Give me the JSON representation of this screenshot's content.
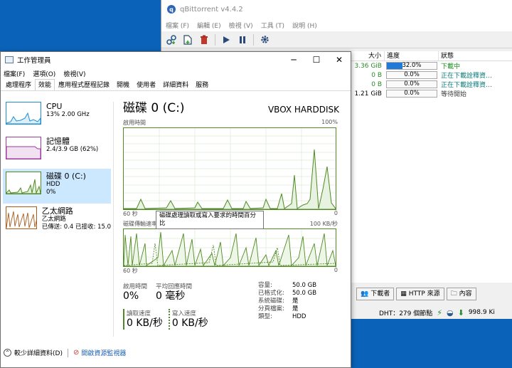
{
  "qbittorrent": {
    "title": "qBittorrent v4.4.2",
    "menu": [
      "檔案 (F)",
      "編輯 (E)",
      "檢視 (V)",
      "工具 (T)",
      "說明 (H)"
    ],
    "columns": {
      "size": "大小",
      "progress": "進度",
      "status": "狀態"
    },
    "rows": [
      {
        "size": "3.36 GiB",
        "progress_text": "32.0%",
        "progress": 0.32,
        "status": "下載中"
      },
      {
        "size": "0 B",
        "progress_text": "0.0%",
        "progress": 0,
        "status": "正在下載詮釋資…"
      },
      {
        "size": "0 B",
        "progress_text": "0.0%",
        "progress": 0,
        "status": "正在下載詮釋資…"
      },
      {
        "size": "1.21 GiB",
        "progress_text": "0.0%",
        "progress": 0,
        "status": "等待開始"
      }
    ],
    "tabs": {
      "peers": "下載者",
      "http": "HTTP 來源",
      "content": "內容"
    },
    "status_bar": {
      "dht": "DHT：279 個節點",
      "speed": "998.9 Ki"
    }
  },
  "taskmgr": {
    "title": "工作管理員",
    "menu": {
      "file": "檔案(F)",
      "options": "選項(O)",
      "view": "檢視(V)"
    },
    "tabs": [
      "處理程序",
      "效能",
      "應用程式歷程記錄",
      "開機",
      "使用者",
      "詳細資料",
      "服務"
    ],
    "active_tab": "效能",
    "sidebar": {
      "cpu": {
        "name": "CPU",
        "line1": "13%  2.00 GHz"
      },
      "memory": {
        "name": "記憶體",
        "line1": "2.4/3.9 GB (62%)"
      },
      "disk": {
        "name": "磁碟 0 (C:)",
        "line1": "HDD",
        "line2": "0%"
      },
      "ethernet": {
        "name": "乙太網路",
        "line1": "乙太網路",
        "line2": "已傳送: 0.4  已接收: 15.0"
      }
    },
    "main": {
      "title": "磁碟 0 (C:)",
      "model": "VBOX HARDDISK",
      "graph1": {
        "label": "啟用時間",
        "max": "100%",
        "time": "60 秒",
        "min": "0"
      },
      "tooltip": "磁碟處理讀取或寫入要求的時間百分比",
      "graph2": {
        "label": "磁碟傳輸速率",
        "max": "100 KB/秒",
        "time": "60 秒",
        "min": "0"
      },
      "active_time_label": "啟用時間",
      "active_time": "0%",
      "response_label": "平均回應時間",
      "response": "0 毫秒",
      "read_label": "讀取速度",
      "read": "0 KB/秒",
      "write_label": "寫入速度",
      "write": "0 KB/秒",
      "specs": [
        {
          "k": "容量:",
          "v": "50.0 GB"
        },
        {
          "k": "已格式化:",
          "v": "50.0 GB"
        },
        {
          "k": "系統磁碟:",
          "v": "是"
        },
        {
          "k": "分頁檔案:",
          "v": "是"
        },
        {
          "k": "類型:",
          "v": "HDD"
        }
      ]
    },
    "footer": {
      "fewer": "較少詳細資料(D)",
      "resmon": "開啟資源監視器"
    }
  }
}
